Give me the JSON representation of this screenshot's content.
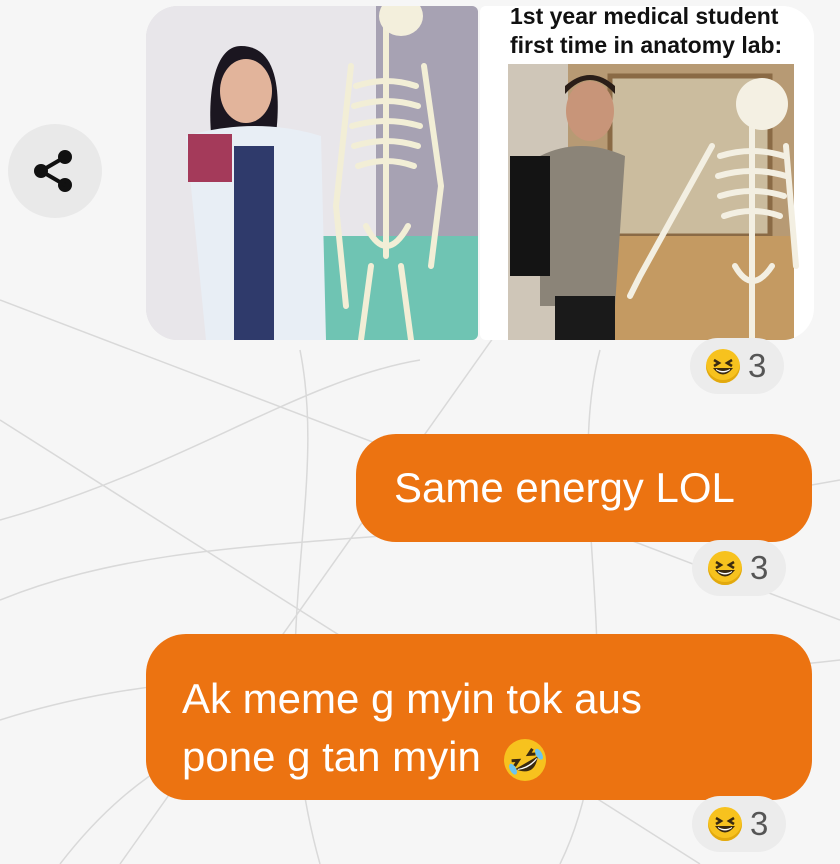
{
  "thread": {
    "share_icon": "share-icon",
    "meme": {
      "caption_line1": "1st year medical student",
      "caption_line2": "first time in anatomy lab:"
    },
    "messages": [
      {
        "text": "Same energy LOL",
        "reaction_icon": "grinning-squinting-face-icon",
        "reaction_count": "3"
      },
      {
        "line1": "Ak meme g myin tok aus",
        "line2": "pone g tan myin",
        "trailing_emoji": "rolling-on-floor-laughing-icon",
        "reaction_icon": "grinning-squinting-face-icon",
        "reaction_count": "3"
      }
    ],
    "image_reaction": {
      "icon": "grinning-squinting-face-icon",
      "count": "3"
    }
  },
  "colors": {
    "bubble": "#ec7311",
    "background": "#f6f6f6",
    "reaction_pill": "#ececec"
  }
}
